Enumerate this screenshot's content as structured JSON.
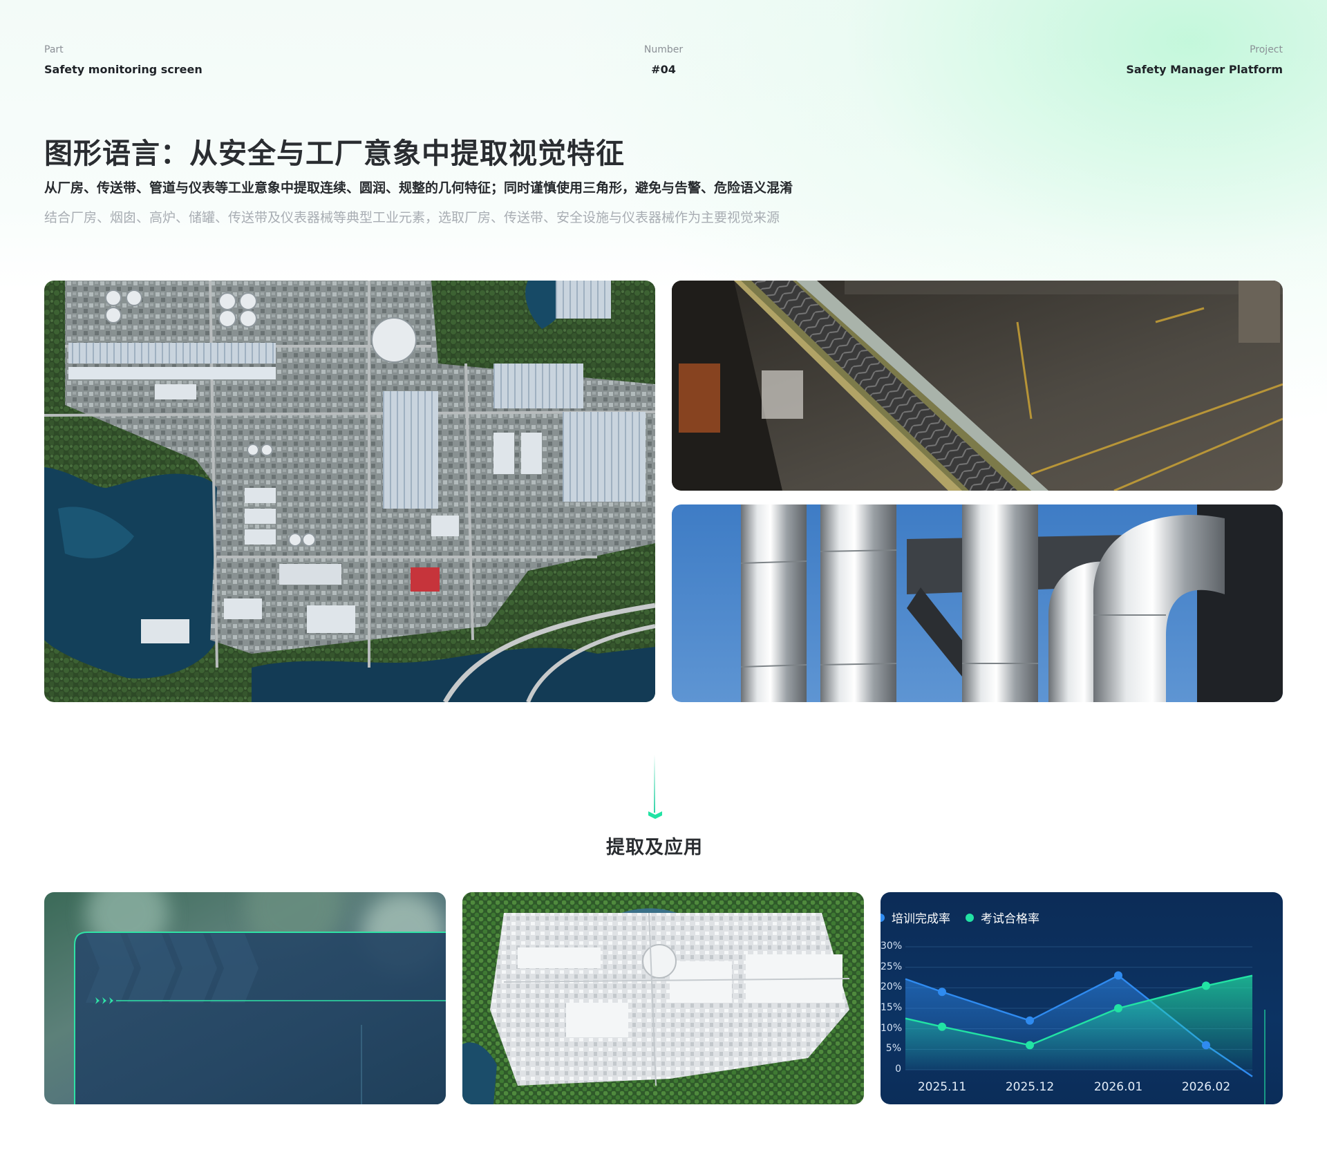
{
  "header": {
    "part_label": "Part",
    "part_value": "Safety monitoring screen",
    "number_label": "Number",
    "number_value": "#04",
    "project_label": "Project",
    "project_value": "Safety Manager Platform"
  },
  "intro": {
    "title": "图形语言：从安全与工厂意象中提取视觉特征",
    "subtitle": "从厂房、传送带、管道与仪表等工业意象中提取连续、圆润、规整的几何特征；同时谨慎使用三角形，避免与告警、危险语义混淆",
    "description": "结合厂房、烟囱、高炉、储罐、传送带及仪表器械等典型工业元素，选取厂房、传送带、安全设施与仪表器械作为主要视觉来源"
  },
  "section": {
    "title": "提取及应用"
  },
  "colors": {
    "accent_green": "#22e3a4",
    "accent_blue": "#2f8bf0",
    "chart_bg": "#0c2f5c"
  },
  "chart_data": {
    "type": "area",
    "categories": [
      "2025.11",
      "2025.12",
      "2026.01",
      "2026.02"
    ],
    "y_tick_labels": [
      "0",
      "5%",
      "10%",
      "15%",
      "20%",
      "25%",
      "30%"
    ],
    "ylim": [
      0,
      30
    ],
    "series": [
      {
        "name": "培训完成率",
        "color": "#2f8bf0",
        "values": [
          19,
          12,
          23,
          6
        ]
      },
      {
        "name": "考试合格率",
        "color": "#22e3a4",
        "values": [
          10.5,
          6,
          15,
          20.5
        ]
      }
    ],
    "legend_position": "top-left",
    "grid": true
  }
}
